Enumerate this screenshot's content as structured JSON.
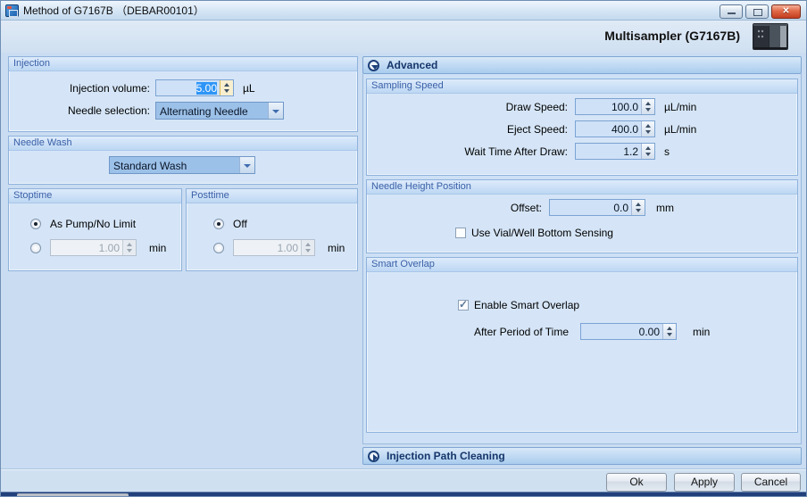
{
  "titlebar": {
    "title": "Method of G7167B （DEBAR00101）"
  },
  "header": {
    "device_title": "Multisampler (G7167B)"
  },
  "injection": {
    "title": "Injection",
    "volume_label": "Injection volume:",
    "volume_value": "5.00",
    "volume_unit": "µL",
    "needle_label": "Needle selection:",
    "needle_value": "Alternating Needle"
  },
  "needle_wash": {
    "title": "Needle Wash",
    "value": "Standard Wash"
  },
  "stoptime": {
    "title": "Stoptime",
    "option_no_limit": "As Pump/No Limit",
    "time_value": "1.00",
    "time_unit": "min"
  },
  "posttime": {
    "title": "Posttime",
    "option_off": "Off",
    "time_value": "1.00",
    "time_unit": "min"
  },
  "advanced": {
    "title": "Advanced",
    "sampling_speed": {
      "title": "Sampling Speed",
      "rows": [
        {
          "label": "Draw Speed:",
          "value": "100.0",
          "unit": "µL/min"
        },
        {
          "label": "Eject Speed:",
          "value": "400.0",
          "unit": "µL/min"
        },
        {
          "label": "Wait Time After Draw:",
          "value": "1.2",
          "unit": "s"
        }
      ]
    },
    "needle_height": {
      "title": "Needle Height Position",
      "offset_label": "Offset:",
      "offset_value": "0.0",
      "offset_unit": "mm",
      "bottom_sensing_label": "Use Vial/Well Bottom Sensing",
      "bottom_sensing_checked": false
    },
    "smart_overlap": {
      "title": "Smart Overlap",
      "enable_label": "Enable Smart Overlap",
      "enable_checked": true,
      "period_label": "After Period of Time",
      "period_value": "0.00",
      "period_unit": "min"
    }
  },
  "injection_path_cleaning": {
    "title": "Injection Path Cleaning"
  },
  "footer": {
    "ok_label": "Ok",
    "apply_label": "Apply",
    "cancel_label": "Cancel"
  },
  "colors": {
    "selection": "#2e95f7",
    "header_text": "#3a60a8",
    "expander_text": "#16366b",
    "close_button": "#c43e22"
  }
}
